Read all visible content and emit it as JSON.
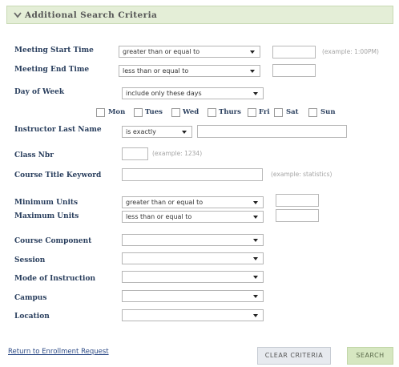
{
  "section": {
    "title": "Additional Search Criteria"
  },
  "fields": {
    "meeting_start": {
      "label": "Meeting Start Time",
      "operator": "greater than or equal to",
      "value": "",
      "hint": "(example: 1:00PM)"
    },
    "meeting_end": {
      "label": "Meeting End Time",
      "operator": "less than or equal to",
      "value": ""
    },
    "day_of_week": {
      "label": "Day of Week",
      "operator": "include only these days"
    },
    "days": [
      "Mon",
      "Tues",
      "Wed",
      "Thurs",
      "Fri",
      "Sat",
      "Sun"
    ],
    "instructor": {
      "label": "Instructor Last Name",
      "operator": "is exactly",
      "value": ""
    },
    "class_nbr": {
      "label": "Class Nbr",
      "value": "",
      "hint": "(example: 1234)"
    },
    "course_title": {
      "label": "Course Title Keyword",
      "value": "",
      "hint": "(example: statistics)"
    },
    "min_units": {
      "label": "Minimum Units",
      "operator": "greater than or equal to",
      "value": ""
    },
    "max_units": {
      "label": "Maximum Units",
      "operator": "less than or equal to",
      "value": ""
    },
    "course_component": {
      "label": "Course Component",
      "value": ""
    },
    "session": {
      "label": "Session",
      "value": ""
    },
    "mode": {
      "label": "Mode of Instruction",
      "value": ""
    },
    "campus": {
      "label": "Campus",
      "value": ""
    },
    "location": {
      "label": "Location",
      "value": ""
    }
  },
  "footer": {
    "return_link": "Return to Enrollment Request",
    "clear_label": "CLEAR CRITERIA",
    "search_label": "SEARCH"
  },
  "colors": {
    "header_bg": "#e4eed7",
    "label": "#2a3f5e",
    "link": "#2c4a86",
    "search_btn": "#d6e7c1"
  },
  "icons": {
    "section_toggle": "chevron-down-icon",
    "dropdown": "dropdown-arrow-icon"
  }
}
